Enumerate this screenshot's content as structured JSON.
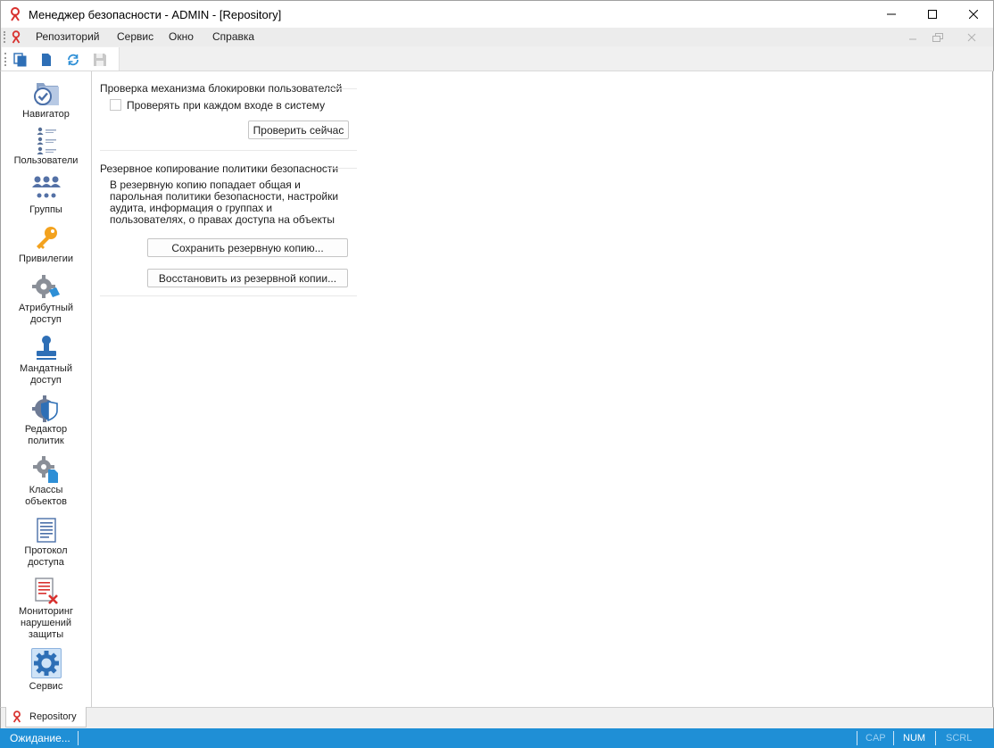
{
  "window": {
    "title": "Менеджер безопасности - ADMIN - [Repository]"
  },
  "menu": [
    "Репозиторий",
    "Сервис",
    "Окно",
    "Справка"
  ],
  "nav": [
    {
      "label": "Навигатор"
    },
    {
      "label": "Пользователи"
    },
    {
      "label": "Группы"
    },
    {
      "label": "Привилегии"
    },
    {
      "label": "Атрибутный\nдоступ"
    },
    {
      "label": "Мандатный\nдоступ"
    },
    {
      "label": "Редактор\nполитик"
    },
    {
      "label": "Классы\nобъектов"
    },
    {
      "label": "Протокол\nдоступа"
    },
    {
      "label": "Мониторинг\nнарушений\nзащиты"
    },
    {
      "label": "Сервис"
    }
  ],
  "lock_section": {
    "heading": "Проверка механизма блокировки пользователей",
    "checkbox_label": "Проверять при каждом входе в систему",
    "check_now": "Проверить сейчас"
  },
  "backup_section": {
    "heading": "Резервное копирование политики безопасности",
    "description": "В резервную копию попадает общая и парольная политики безопасности, настройки аудита, информация о группах и пользователях, о правах доступа на объекты",
    "save_backup": "Сохранить резервную копию...",
    "restore_backup": "Восстановить из резервной копии..."
  },
  "doc_tab": {
    "label": "Repository"
  },
  "status": {
    "main": "Ожидание...",
    "cap": "CAP",
    "num": "NUM",
    "scrl": "SCRL"
  },
  "colors": {
    "accent": "#1f8fd6",
    "icon_blue": "#2e6fb6",
    "selection": "#cfe3f7"
  }
}
